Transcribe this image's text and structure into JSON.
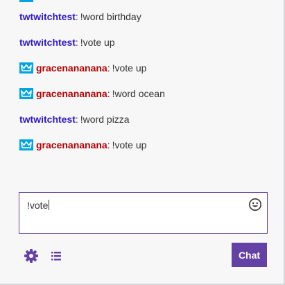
{
  "colors": {
    "accent": "#6441a4",
    "broadcaster_badge": "#00a4e0",
    "user_twtwitchtest": "#2e19c8",
    "user_gracenanana": "#b30000"
  },
  "messages": [
    {
      "user": "twtwitchtest",
      "separator": ":",
      "text": "!word birthday",
      "badge": null
    },
    {
      "user": "twtwitchtest",
      "separator": ":",
      "text": "!vote up",
      "badge": null
    },
    {
      "user": "gracenananana",
      "separator": ":",
      "text": "!vote up",
      "badge": "crown-icon"
    },
    {
      "user": "gracenananana",
      "separator": ":",
      "text": "!word ocean",
      "badge": "crown-icon"
    },
    {
      "user": "twtwitchtest",
      "separator": ":",
      "text": "!word pizza",
      "badge": null
    },
    {
      "user": "gracenananana",
      "separator": ":",
      "text": "!vote up",
      "badge": "crown-icon"
    }
  ],
  "chat_input": {
    "value": "!vote"
  },
  "icons": {
    "emoji": "smiley-icon",
    "settings": "gear-icon",
    "viewer_list": "list-icon"
  },
  "chat_button": {
    "label": "Chat"
  }
}
